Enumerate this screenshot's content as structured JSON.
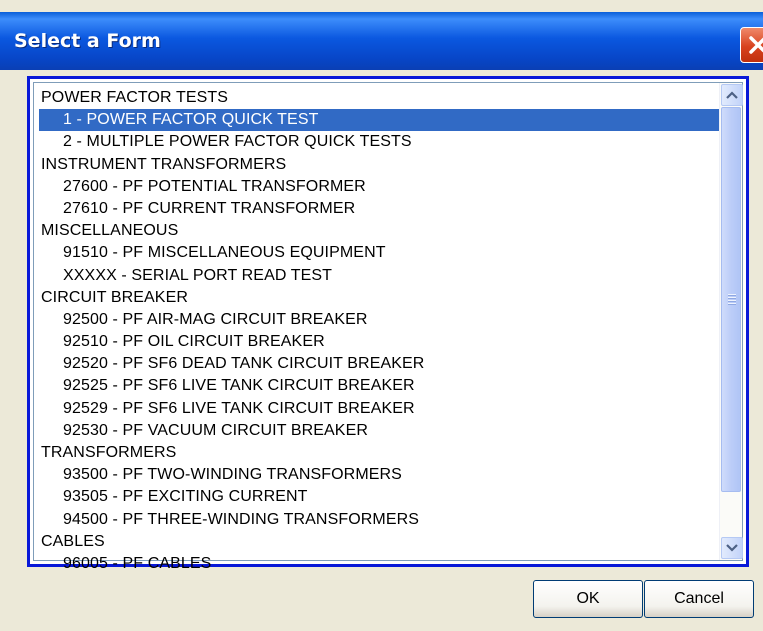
{
  "window": {
    "title": "Select a Form"
  },
  "list": {
    "items": [
      {
        "label": "POWER FACTOR TESTS",
        "type": "category"
      },
      {
        "label": "1 - POWER FACTOR QUICK TEST",
        "type": "form",
        "selected": true
      },
      {
        "label": "2 - MULTIPLE POWER FACTOR QUICK TESTS",
        "type": "form"
      },
      {
        "label": "INSTRUMENT TRANSFORMERS",
        "type": "category"
      },
      {
        "label": "27600 - PF POTENTIAL TRANSFORMER",
        "type": "form"
      },
      {
        "label": "27610 - PF CURRENT TRANSFORMER",
        "type": "form"
      },
      {
        "label": "MISCELLANEOUS",
        "type": "category"
      },
      {
        "label": "91510 - PF MISCELLANEOUS EQUIPMENT",
        "type": "form"
      },
      {
        "label": "XXXXX - SERIAL PORT READ TEST",
        "type": "form"
      },
      {
        "label": "CIRCUIT BREAKER",
        "type": "category"
      },
      {
        "label": "92500 - PF AIR-MAG CIRCUIT BREAKER",
        "type": "form"
      },
      {
        "label": "92510 - PF OIL CIRCUIT BREAKER",
        "type": "form"
      },
      {
        "label": "92520 - PF SF6 DEAD TANK CIRCUIT BREAKER",
        "type": "form"
      },
      {
        "label": "92525 - PF SF6 LIVE TANK CIRCUIT BREAKER",
        "type": "form"
      },
      {
        "label": "92529 - PF SF6 LIVE TANK CIRCUIT BREAKER",
        "type": "form"
      },
      {
        "label": "92530 - PF VACUUM CIRCUIT BREAKER",
        "type": "form"
      },
      {
        "label": "TRANSFORMERS",
        "type": "category"
      },
      {
        "label": "93500 - PF  TWO-WINDING TRANSFORMERS",
        "type": "form"
      },
      {
        "label": "93505 - PF  EXCITING CURRENT",
        "type": "form"
      },
      {
        "label": "94500 - PF THREE-WINDING TRANSFORMERS",
        "type": "form"
      },
      {
        "label": "CABLES",
        "type": "category"
      },
      {
        "label": "96005 - PF CABLES",
        "type": "form"
      }
    ]
  },
  "buttons": {
    "ok": "OK",
    "cancel": "Cancel"
  },
  "icons": {
    "close": "close-icon",
    "scroll_up": "chevron-up-icon",
    "scroll_down": "chevron-down-icon"
  },
  "colors": {
    "titlebar": "#0b58e0",
    "selection": "#316ac5",
    "focus_border": "#0818d8",
    "close": "#d8421e"
  }
}
